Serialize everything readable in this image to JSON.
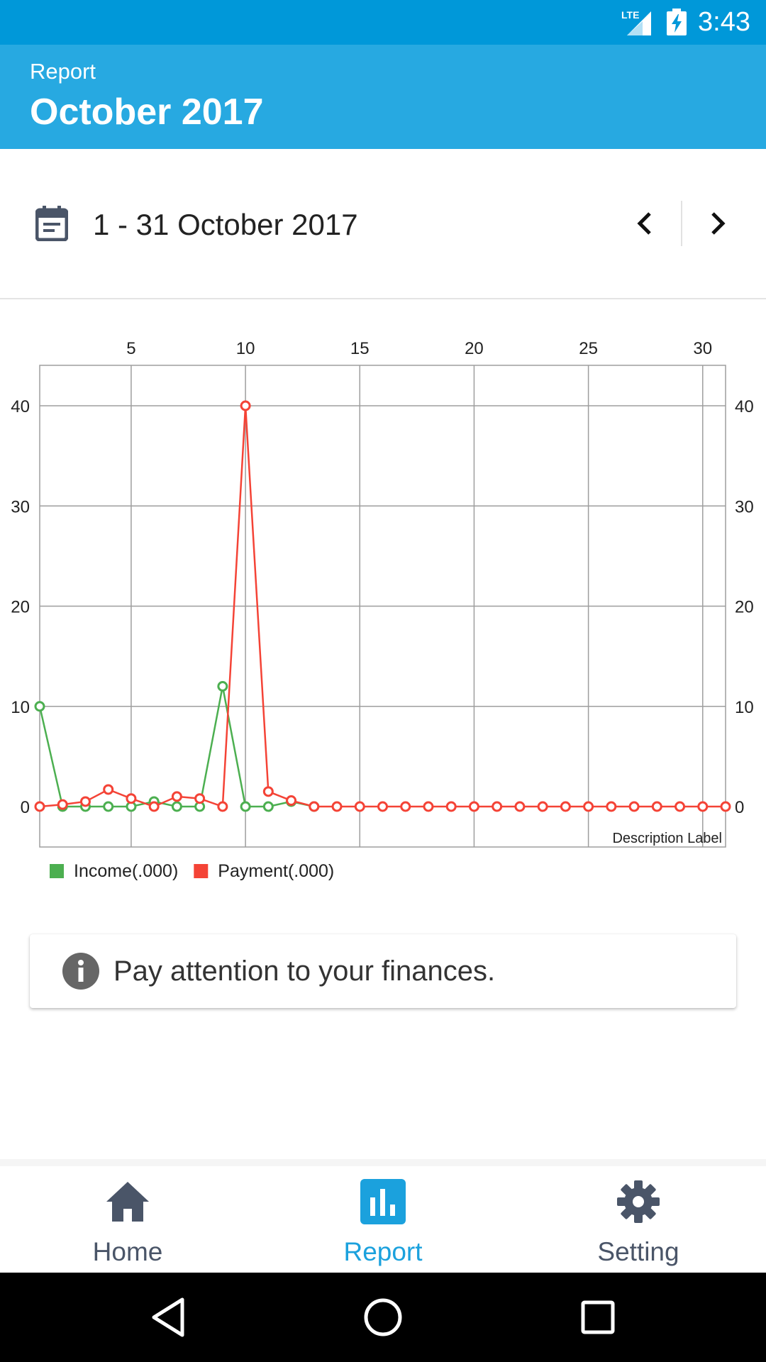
{
  "status_bar": {
    "network": "LTE",
    "time": "3:43"
  },
  "app_bar": {
    "subtitle": "Report",
    "title": "October 2017"
  },
  "period": {
    "label": "1 - 31 October 2017",
    "prev_icon": "chevron-left-icon",
    "next_icon": "chevron-right-icon"
  },
  "chart_data": {
    "type": "line",
    "x": [
      1,
      2,
      3,
      4,
      5,
      6,
      7,
      8,
      9,
      10,
      11,
      12,
      13,
      14,
      15,
      16,
      17,
      18,
      19,
      20,
      21,
      22,
      23,
      24,
      25,
      26,
      27,
      28,
      29,
      30,
      31
    ],
    "x_ticks": [
      5,
      10,
      15,
      20,
      25,
      30
    ],
    "y_ticks": [
      0,
      10,
      20,
      30,
      40
    ],
    "xlim": [
      1,
      31
    ],
    "ylim": [
      -4,
      44
    ],
    "description": "Description Label",
    "grid": true,
    "legend_position": "bottom-left",
    "series": [
      {
        "name": "Income(.000)",
        "color": "#4caf50",
        "values": [
          10,
          0,
          0,
          0,
          0,
          0.5,
          0,
          0,
          12,
          0,
          0,
          0.5,
          0
        ]
      },
      {
        "name": "Payment(.000)",
        "color": "#f44336",
        "values": [
          0,
          0.2,
          0.5,
          1.7,
          0.8,
          0,
          1,
          0.8,
          0,
          40,
          1.5,
          0.6,
          0,
          0,
          0,
          0,
          0,
          0,
          0,
          0,
          0,
          0,
          0,
          0,
          0,
          0,
          0,
          0,
          0,
          0,
          0
        ]
      }
    ]
  },
  "info_card": {
    "icon": "info-icon",
    "text": "Pay attention to your finances."
  },
  "bottom_nav": {
    "items": [
      {
        "label": "Home",
        "icon": "home-icon",
        "active": false
      },
      {
        "label": "Report",
        "icon": "bar-chart-icon",
        "active": true
      },
      {
        "label": "Setting",
        "icon": "gear-icon",
        "active": false
      }
    ]
  },
  "colors": {
    "status_bar": "#0098d9",
    "app_bar": "#27a9e1",
    "accent": "#1ba1dd",
    "nav_inactive": "#4a5568"
  }
}
